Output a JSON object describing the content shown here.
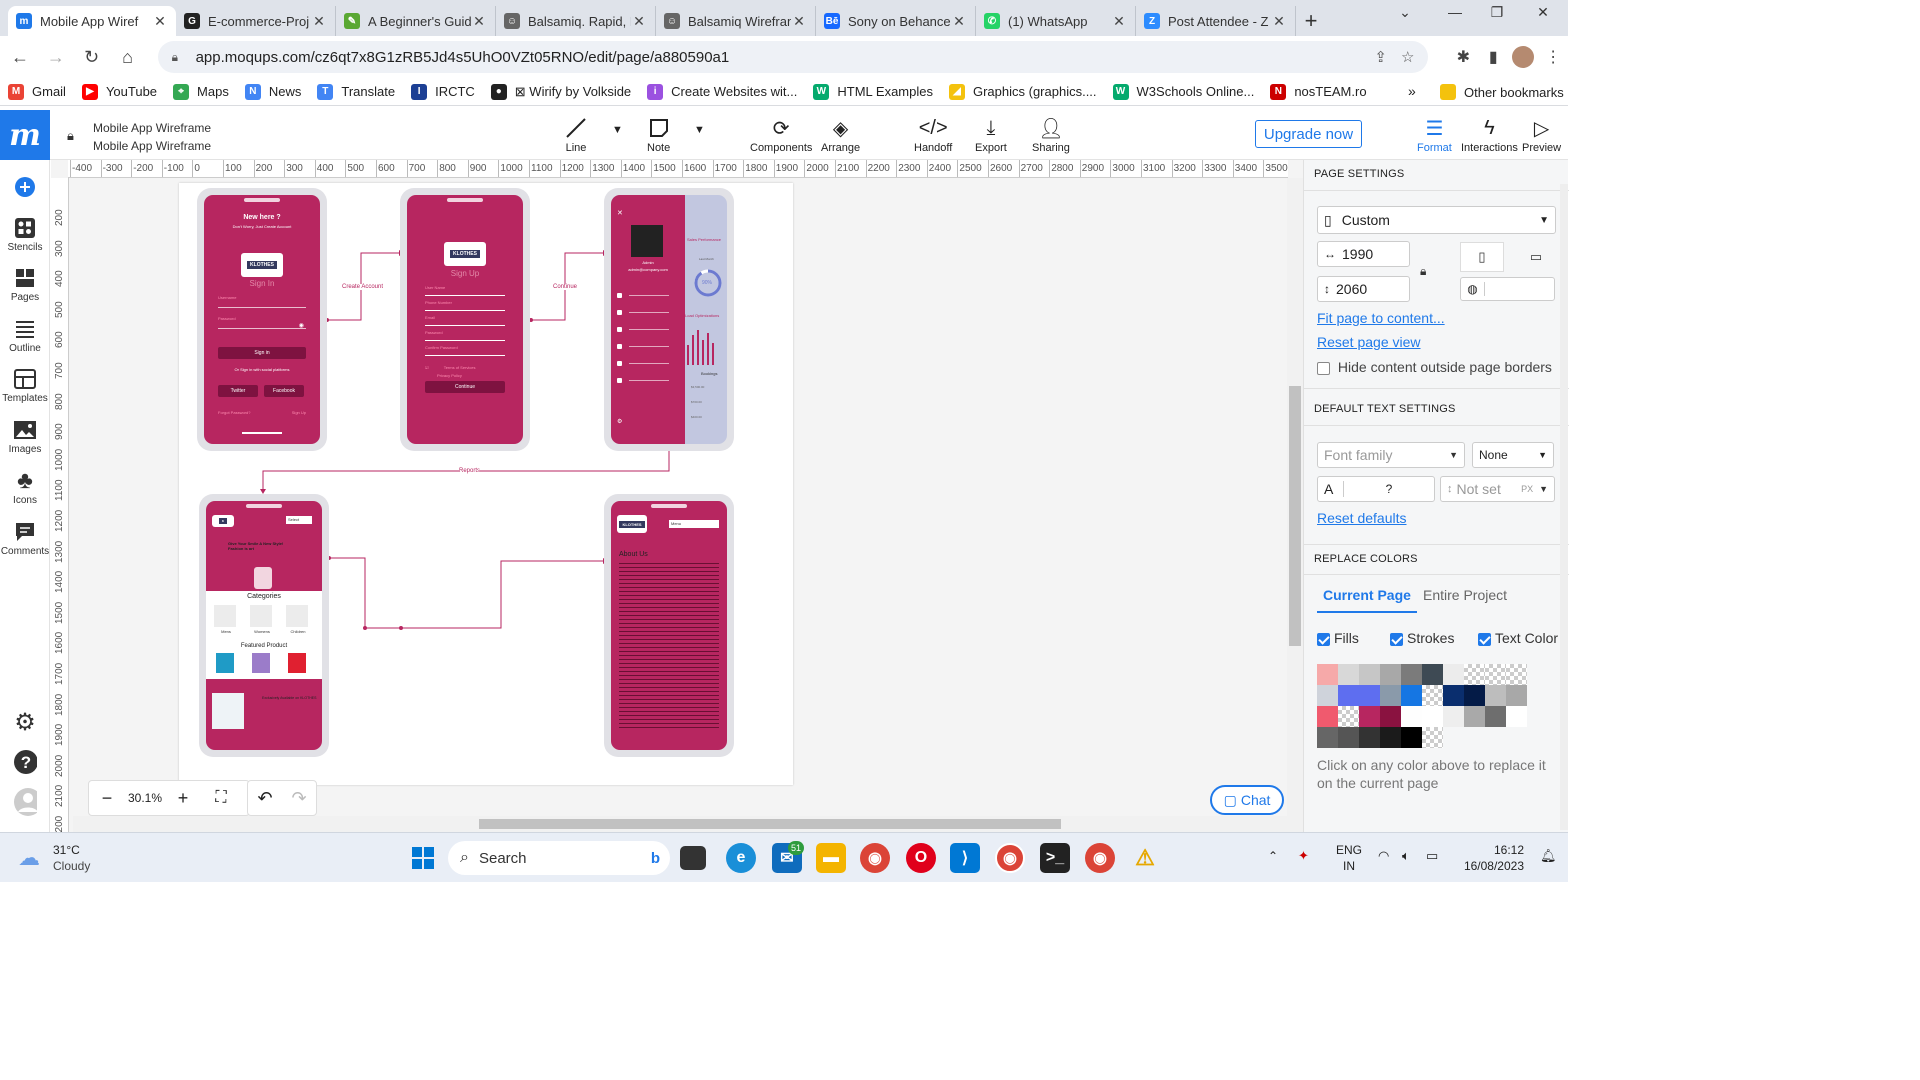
{
  "browser": {
    "tabs": [
      {
        "title": "Mobile App Wiref",
        "icon": "moqups-icon",
        "color": "#1f79e9",
        "glyph": "m",
        "active": true
      },
      {
        "title": "E-commerce-Proj",
        "icon": "github-icon",
        "color": "#222222",
        "glyph": "G"
      },
      {
        "title": "A Beginner's Guid",
        "icon": "leaf-icon",
        "color": "#5aa833",
        "glyph": "✎"
      },
      {
        "title": "Balsamiq. Rapid, E",
        "icon": "balsamiq-icon",
        "color": "#666666",
        "glyph": "☺"
      },
      {
        "title": "Balsamiq Wirefram",
        "icon": "balsamiq-icon",
        "color": "#666666",
        "glyph": "☺"
      },
      {
        "title": "Sony on Behance",
        "icon": "behance-icon",
        "color": "#1769ff",
        "glyph": "Bē"
      },
      {
        "title": "(1) WhatsApp",
        "icon": "whatsapp-icon",
        "color": "#25d366",
        "glyph": "✆"
      },
      {
        "title": "Post Attendee - Z",
        "icon": "zoom-icon",
        "color": "#2d8cff",
        "glyph": "Z"
      }
    ],
    "url": "app.moqups.com/cz6qt7x8G1zRB5Jd4s5UhO0VZt05RNO/edit/page/a880590a1",
    "bookmarks": [
      {
        "label": "Gmail",
        "icon": "gmail-icon",
        "color": "#ea4335",
        "glyph": "M"
      },
      {
        "label": "YouTube",
        "icon": "youtube-icon",
        "color": "#ff0000",
        "glyph": "▶"
      },
      {
        "label": "Maps",
        "icon": "maps-icon",
        "color": "#34a853",
        "glyph": "⌖"
      },
      {
        "label": "News",
        "icon": "news-icon",
        "color": "#4285f4",
        "glyph": "N"
      },
      {
        "label": "Translate",
        "icon": "translate-icon",
        "color": "#4285f4",
        "glyph": "T"
      },
      {
        "label": "IRCTC",
        "icon": "irctc-icon",
        "color": "#1c3f94",
        "glyph": "I"
      },
      {
        "label": "⊠ Wirify by Volkside",
        "icon": "wirify-icon",
        "color": "#222222",
        "glyph": "●"
      },
      {
        "label": "Create Websites wit...",
        "icon": "create-websites-icon",
        "color": "#9b51e0",
        "glyph": "i"
      },
      {
        "label": "HTML Examples",
        "icon": "html-examples-icon",
        "color": "#04aa6d",
        "glyph": "W"
      },
      {
        "label": "Graphics (graphics....",
        "icon": "graphics-icon",
        "color": "#f4c20d",
        "glyph": "◢"
      },
      {
        "label": "W3Schools Online...",
        "icon": "w3schools-icon",
        "color": "#04aa6d",
        "glyph": "W"
      },
      {
        "label": "nosTEAM.ro",
        "icon": "nosteam-icon",
        "color": "#cc0000",
        "glyph": "N"
      }
    ],
    "other_bookmarks": "Other bookmarks"
  },
  "app": {
    "project_title": "Mobile App Wireframe",
    "page_title": "Mobile App Wireframe",
    "toolbar": {
      "line": "Line",
      "note": "Note",
      "components": "Components",
      "arrange": "Arrange",
      "handoff": "Handoff",
      "export": "Export",
      "sharing": "Sharing",
      "upgrade": "Upgrade now",
      "format": "Format",
      "interactions": "Interactions",
      "preview": "Preview"
    },
    "sidebar": [
      {
        "label": "",
        "icon": "add-icon"
      },
      {
        "label": "Stencils",
        "icon": "stencils-icon"
      },
      {
        "label": "Pages",
        "icon": "pages-icon"
      },
      {
        "label": "Outline",
        "icon": "outline-icon"
      },
      {
        "label": "Templates",
        "icon": "templates-icon"
      },
      {
        "label": "Images",
        "icon": "images-icon"
      },
      {
        "label": "Icons",
        "icon": "icons-icon"
      },
      {
        "label": "Comments",
        "icon": "comments-icon"
      }
    ],
    "ruler": {
      "h": [
        "-400",
        "-300",
        "-200",
        "-100",
        "0",
        "100",
        "200",
        "300",
        "400",
        "500",
        "600",
        "700",
        "800",
        "900",
        "1000",
        "1100",
        "1200",
        "1300",
        "1400",
        "1500",
        "1600",
        "1700",
        "1800",
        "1900",
        "2000",
        "2100",
        "2200",
        "2300",
        "2400",
        "2500",
        "2600",
        "2700",
        "2800",
        "2900",
        "3000",
        "3100",
        "3200",
        "3300",
        "3400",
        "3500",
        "360"
      ],
      "v": [
        "200",
        "300",
        "400",
        "500",
        "600",
        "700",
        "800",
        "900",
        "1000",
        "1100",
        "1200",
        "1300",
        "1400",
        "1500",
        "1600",
        "1700",
        "1800",
        "1900",
        "2000",
        "2100",
        "2200"
      ]
    },
    "zoom": "30.1%",
    "chat": "Chat",
    "flows": {
      "create_account": "Create Account",
      "continue": "Continue",
      "reports": "Reports"
    },
    "screens": {
      "signin": {
        "heading": "New here ?",
        "sub": "Don't Worry, Just Create Account",
        "logo": "KLOTHES",
        "title": "Sign In",
        "username": "Username",
        "password": "Password",
        "button": "Sign in",
        "or": "Or Sign in with social platforms",
        "twitter": "Twitter",
        "facebook": "Facebook",
        "forgot": "Forgot Password?",
        "signup": "Sign Up"
      },
      "signup": {
        "logo": "KLOTHES",
        "title": "Sign Up",
        "fields": [
          "User Name",
          "Phone Number",
          "Email",
          "Password",
          "Confirm Password"
        ],
        "terms": "Terms of Services",
        "privacy": "Privacy Policy",
        "button": "Continue"
      },
      "dashboard": {
        "admin": "Admin",
        "email": "admin@company.com",
        "sales": "Sales Performance",
        "last": "Last Month",
        "pct": "90%",
        "load": "Load Optimizations",
        "bookings": "Bookings",
        "values": [
          "$3,500.00",
          "$700.00",
          "$400.00"
        ]
      },
      "home": {
        "select": "Select",
        "tagline": "Give Your Smile A New Style! Fashion is art",
        "categories": "Categories",
        "cats": [
          "Mens",
          "Womens",
          "Children"
        ],
        "featured": "Featured Product",
        "promo": "Exclusively Available on KLOTHES"
      },
      "about": {
        "logo": "KLOTHES",
        "menu": "Menu",
        "title": "About Us"
      }
    }
  },
  "panel": {
    "page_settings": "PAGE SETTINGS",
    "size_preset": "Custom",
    "width": "1990",
    "height": "2060",
    "fit": "Fit page to content...",
    "reset_view": "Reset page view",
    "hide_outside": "Hide content outside page borders",
    "default_text": "DEFAULT TEXT SETTINGS",
    "font_family": "Font family",
    "font_style": "None",
    "font_size_label": "A",
    "font_size": "?",
    "line_height": "Not set",
    "line_unit": "PX",
    "reset_defaults": "Reset defaults",
    "replace_colors": "REPLACE COLORS",
    "tab_current": "Current Page",
    "tab_project": "Entire Project",
    "fills": "Fills",
    "strokes": "Strokes",
    "text_color": "Text Color",
    "hint": "Click on any color above to replace it on the current page",
    "swatches": [
      "#f6a9a9",
      "#d8d8d8",
      "#c6c6c6",
      "#a8a8a8",
      "#7b7b7b",
      "#3e4a54",
      "#ececec",
      "checker",
      "checker",
      "checker",
      "#cfd3db",
      "#5e6ef0",
      "#5e6ef0",
      "#8a9aaa",
      "#1576e3",
      "checker",
      "#0a2e6e",
      "#041b47",
      "#bdbdbd",
      "#a8a8a8",
      "#f05a6e",
      "checker",
      "#b72660",
      "#8a1240",
      "#fefefe",
      "#ffffff",
      "#eeeeee",
      "#a9a9a9",
      "#6e6e6e",
      "#ffffff",
      "#666666",
      "#555555",
      "#333333",
      "#1b1b1b",
      "#000000",
      "checker"
    ]
  },
  "taskbar": {
    "temp": "31°C",
    "weather": "Cloudy",
    "search": "Search",
    "badge": "51",
    "lang": "ENG",
    "region": "IN",
    "time": "16:12",
    "date": "16/08/2023"
  }
}
